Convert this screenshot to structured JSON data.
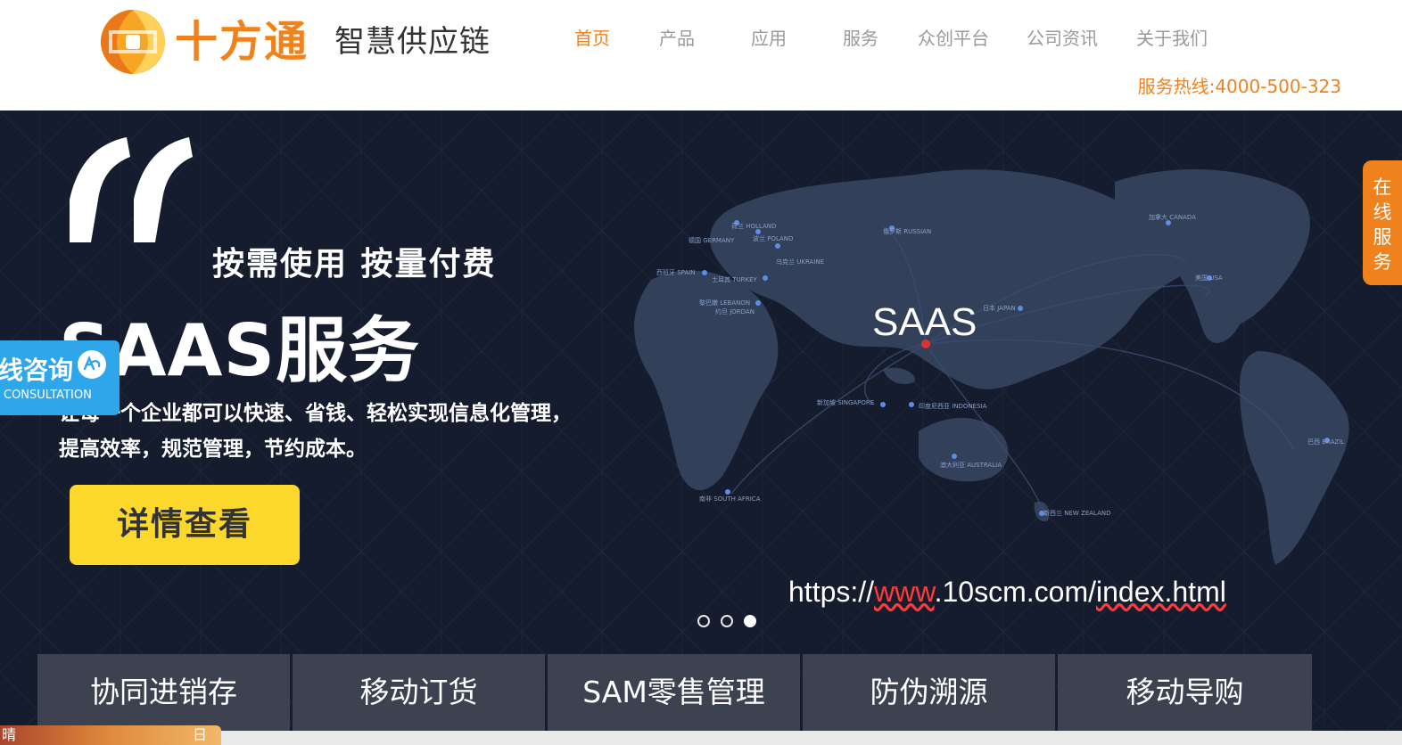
{
  "header": {
    "brand": "十方通",
    "slogan": "智慧供应链",
    "nav": [
      {
        "label": "首页",
        "active": true
      },
      {
        "label": "产品",
        "active": false
      },
      {
        "label": "应用",
        "active": false
      },
      {
        "label": "服务",
        "active": false
      },
      {
        "label": "众创平台",
        "active": false
      },
      {
        "label": "公司资讯",
        "active": false
      },
      {
        "label": "关于我们",
        "active": false
      }
    ],
    "hotline": "服务热线:4000-500-323"
  },
  "banner": {
    "tagline": "按需使用  按量付费",
    "title": "SAAS服务",
    "description": "让每一个企业都可以快速、省钱、轻松实现信息化管理，提高效率，规范管理，节约成本。",
    "button_label": "详情查看",
    "map_center_label": "SAAS",
    "map_cities": [
      "荷兰 HOLLAND",
      "德国 GERMANY",
      "波兰 POLAND",
      "俄罗斯 RUSSIAN",
      "加拿大 CANADA",
      "乌克兰 UKRAINE",
      "西班牙 SPAIN",
      "土耳其 TURKEY",
      "黎巴嫩 LEBANON",
      "约旦 JORDAN",
      "日本 JAPAN",
      "美国 USA",
      "新加坡 SINGAPORE",
      "印度尼西亚 INDONESIA",
      "澳大利亚 AUSTRALIA",
      "南非 SOUTH AFRICA",
      "新西兰 NEW ZEALAND",
      "巴西 BRAZIL"
    ],
    "url_parts": {
      "prefix": "https://",
      "www": "www",
      "middle": ".10scm.com/",
      "index": "index.html"
    },
    "slides": 3,
    "active_slide": 3
  },
  "consult": {
    "title": "在线咨询",
    "title_visible": "线咨询",
    "subtitle": "CONSULTATION"
  },
  "online_service": {
    "label": "在线服务",
    "chars": [
      "在",
      "线",
      "服",
      "务"
    ]
  },
  "tabs": [
    "协同进销存",
    "移动订货",
    "SAM零售管理",
    "防伪溯源",
    "移动导购"
  ],
  "bottom": {
    "left_text": "晴",
    "right_text": "日"
  },
  "colors": {
    "brand_orange": "#f0821e",
    "banner_bg": "#141c2d",
    "button_yellow": "#fcd82c",
    "consult_blue": "#2fa6e9",
    "tab_bg": "#3c4250"
  }
}
